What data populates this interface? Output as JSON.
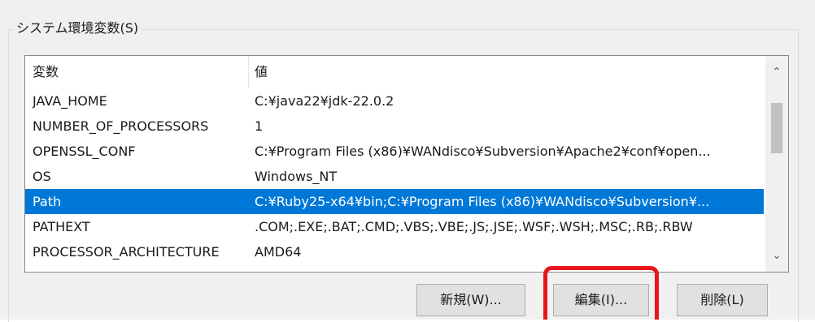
{
  "group": {
    "title": "システム環境変数(S)"
  },
  "list": {
    "headers": {
      "name": "変数",
      "value": "値"
    },
    "rows": [
      {
        "name": "JAVA_HOME",
        "value": "C:¥java22¥jdk-22.0.2",
        "selected": false
      },
      {
        "name": "NUMBER_OF_PROCESSORS",
        "value": "1",
        "selected": false
      },
      {
        "name": "OPENSSL_CONF",
        "value": "C:¥Program Files (x86)¥WANdisco¥Subversion¥Apache2¥conf¥open...",
        "selected": false
      },
      {
        "name": "OS",
        "value": "Windows_NT",
        "selected": false
      },
      {
        "name": "Path",
        "value": "C:¥Ruby25-x64¥bin;C:¥Program Files (x86)¥WANdisco¥Subversion¥...",
        "selected": true
      },
      {
        "name": "PATHEXT",
        "value": ".COM;.EXE;.BAT;.CMD;.VBS;.VBE;.JS;.JSE;.WSF;.WSH;.MSC;.RB;.RBW",
        "selected": false
      },
      {
        "name": "PROCESSOR_ARCHITECTURE",
        "value": "AMD64",
        "selected": false
      }
    ],
    "scroll": {
      "up_icon": "chevron-up-icon",
      "down_icon": "chevron-down-icon",
      "up_glyph": "⌃",
      "down_glyph": "⌄"
    }
  },
  "buttons": {
    "new_label": "新規(W)...",
    "edit_label": "編集(I)...",
    "delete_label": "削除(L)"
  },
  "colors": {
    "selection": "#0078d7",
    "highlight": "#e8151c"
  }
}
